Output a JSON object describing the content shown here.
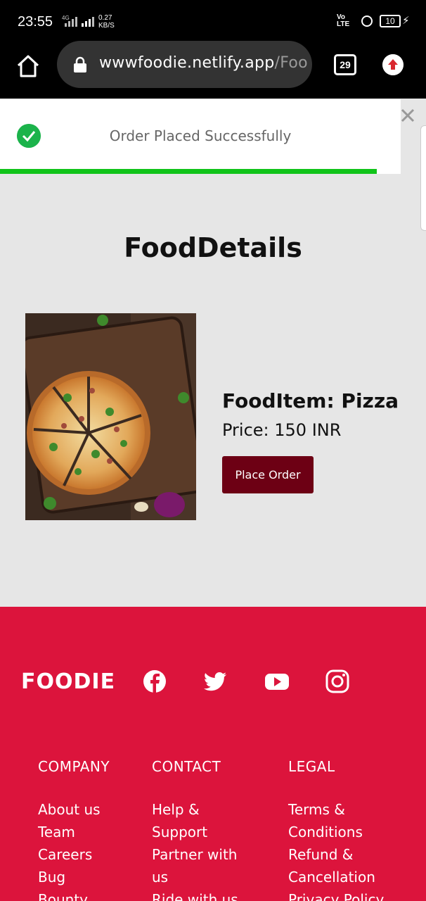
{
  "status_bar": {
    "time": "23:55",
    "network": "4G",
    "speed_value": "0.27",
    "speed_unit": "KB/S",
    "volte": "Vo LTE",
    "battery": "10"
  },
  "browser": {
    "url_main": "wwwfoodie.netlify.app",
    "url_rest": "/Foo",
    "tab_count": "29"
  },
  "toast": {
    "message": "Order Placed Successfully",
    "progress": 0.94
  },
  "main": {
    "title": "FoodDetails",
    "food_item": "FoodItem: Pizza",
    "price": "Price: 150 INR",
    "order_button": "Place Order"
  },
  "footer": {
    "brand": "FOODIE",
    "social_icons": [
      "facebook-icon",
      "twitter-icon",
      "youtube-icon",
      "instagram-icon"
    ],
    "columns": [
      {
        "heading": "COMPANY",
        "links": [
          "About us",
          "Team",
          "Careers",
          "Bug",
          "Bounty"
        ]
      },
      {
        "heading": "CONTACT",
        "links": [
          "Help &",
          "Support",
          "Partner with",
          "us",
          "Ride with us"
        ]
      },
      {
        "heading": "LEGAL",
        "links": [
          "Terms &",
          "Conditions",
          "Refund &",
          "Cancellation",
          "Privacy Policy"
        ]
      }
    ]
  },
  "colors": {
    "footer_bg": "#dc143c",
    "order_button_bg": "#6d0014",
    "toast_progress": "#11c41a",
    "check": "#1bb34b"
  }
}
